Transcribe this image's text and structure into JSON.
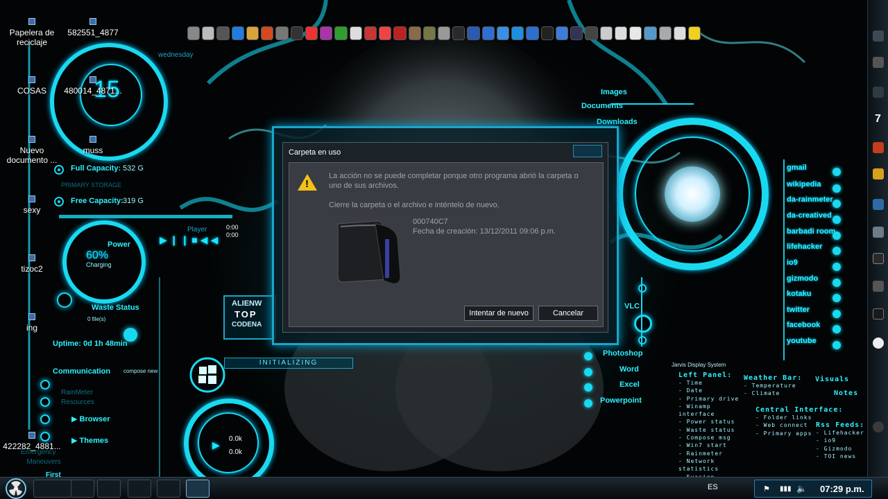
{
  "desktop_icons": [
    {
      "label": "Papelera de reciclaje"
    },
    {
      "label": "582551_4877"
    },
    {
      "label": "COSAS"
    },
    {
      "label": "480014_4871..."
    },
    {
      "label": "Nuevo documento ..."
    },
    {
      "label": "muss"
    },
    {
      "label": "sexy"
    },
    {
      "label": "tizoc2"
    },
    {
      "label": "ing"
    },
    {
      "label": "422282_4881..."
    }
  ],
  "left_hud": {
    "day": "wednesday",
    "date_number": "15",
    "full_capacity_label": "Full Capacity:",
    "full_capacity_value": "532 G",
    "primary_storage": "PRIMARY STORAGE",
    "free_capacity_label": "Free Capacity:",
    "free_capacity_value": "319 G",
    "player_label": "Player",
    "player_time_1": "0:00",
    "player_time_2": "0:00",
    "power_label": "Power",
    "power_percent": "60%",
    "power_state": "Charging",
    "waste_label": "Waste Status",
    "waste_files": "0 file(s)",
    "uptime": "Uptime: 0d 1h 48min",
    "communication": "Communication",
    "compose": "compose new",
    "rainmeter": "RainMeter",
    "resources": "Resources",
    "browser": "Browser",
    "themes": "Themes",
    "emergency": "Emergency",
    "maneuvers": "Maneuvers",
    "first": "First",
    "net_1": "0.0k",
    "net_2": "0.0k"
  },
  "center": {
    "alienware": "ALIENW",
    "top": "TOP",
    "codename": "CODENA",
    "initializing": "INITIALIZING"
  },
  "right_hud": {
    "images": "Images",
    "documents": "Documents",
    "downloads": "Downloads",
    "vlc": "VLC",
    "photoshop": "Photoshop",
    "word": "Word",
    "excel": "Excel",
    "powerpoint": "Powerpoint",
    "links": [
      "gmail",
      "wikipedia",
      "da-rainmeter",
      "da-creatived",
      "barbadi room",
      "lifehacker",
      "io9",
      "gizmodo",
      "kotaku",
      "twitter",
      "facebook",
      "youtube"
    ],
    "jarvis": "Jarvis Display System",
    "left_panel_title": "Left Panel:",
    "left_panel_items": [
      "- Time",
      "- Date",
      "- Primary drive",
      "- Winamp interface",
      "- Power status",
      "- Waste status",
      "- Compose msg",
      "- Win7 start",
      "- Rainmeter",
      "- Network statistics",
      "- Evasion"
    ],
    "weather_title": "Weather Bar:",
    "weather_items": [
      "- Temperature",
      "- Climate"
    ],
    "visuals": "Visuals",
    "notes": "Notes",
    "central_title": "Central Interface:",
    "central_items": [
      "- Folder links",
      "- Web connect",
      "- Primary apps"
    ],
    "rss_title": "Rss Feeds:",
    "rss_items": [
      "- Lifehacker",
      "- io9",
      "- Gizmodo",
      "- TOI news"
    ]
  },
  "dialog": {
    "title": "Carpeta en uso",
    "message": "La acción no se puede completar porque otro programa abrió la carpeta o uno de sus archivos.",
    "instruction": "Cierre la carpeta o el archivo e inténtelo de nuevo.",
    "item_name": "000740C7",
    "item_date": "Fecha de creación: 13/12/2011 09:06 p.m.",
    "retry_label": "Intentar de nuevo",
    "cancel_label": "Cancelar"
  },
  "taskbar": {
    "language": "ES",
    "clock": "07:29 p.m."
  },
  "sidebar": {
    "number": "7"
  },
  "colors": {
    "accent": "#19d9f0",
    "dialog_bg": "#393c42",
    "warning": "#f2c21b"
  }
}
